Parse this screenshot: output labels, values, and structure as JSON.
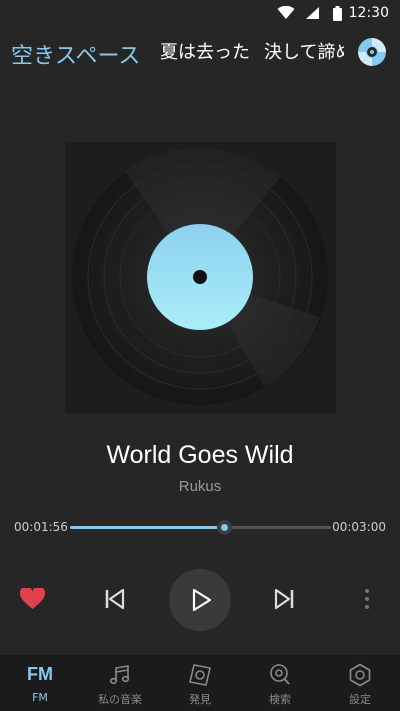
{
  "status": {
    "time": "12:30"
  },
  "header": {
    "tabs": [
      {
        "label": "空きスペース",
        "active": true
      },
      {
        "label": "夏は去った",
        "active": false
      },
      {
        "label": "決して諦め",
        "active": false
      }
    ],
    "disc_icon": "disc-icon"
  },
  "player": {
    "title": "World Goes Wild",
    "artist": "Rukus",
    "elapsed": "00:01:56",
    "total": "00:03:00",
    "progress": 0.59,
    "liked": true
  },
  "nav": {
    "items": [
      {
        "label": "FM",
        "icon": "fm-text",
        "active": true
      },
      {
        "label": "私の音楽",
        "icon": "music-note-icon",
        "active": false
      },
      {
        "label": "発見",
        "icon": "discover-icon",
        "active": false
      },
      {
        "label": "検索",
        "icon": "search-icon",
        "active": false
      },
      {
        "label": "設定",
        "icon": "settings-icon",
        "active": false
      }
    ]
  },
  "colors": {
    "accent": "#86c9ee",
    "heart": "#e0424c",
    "background": "#262626"
  }
}
